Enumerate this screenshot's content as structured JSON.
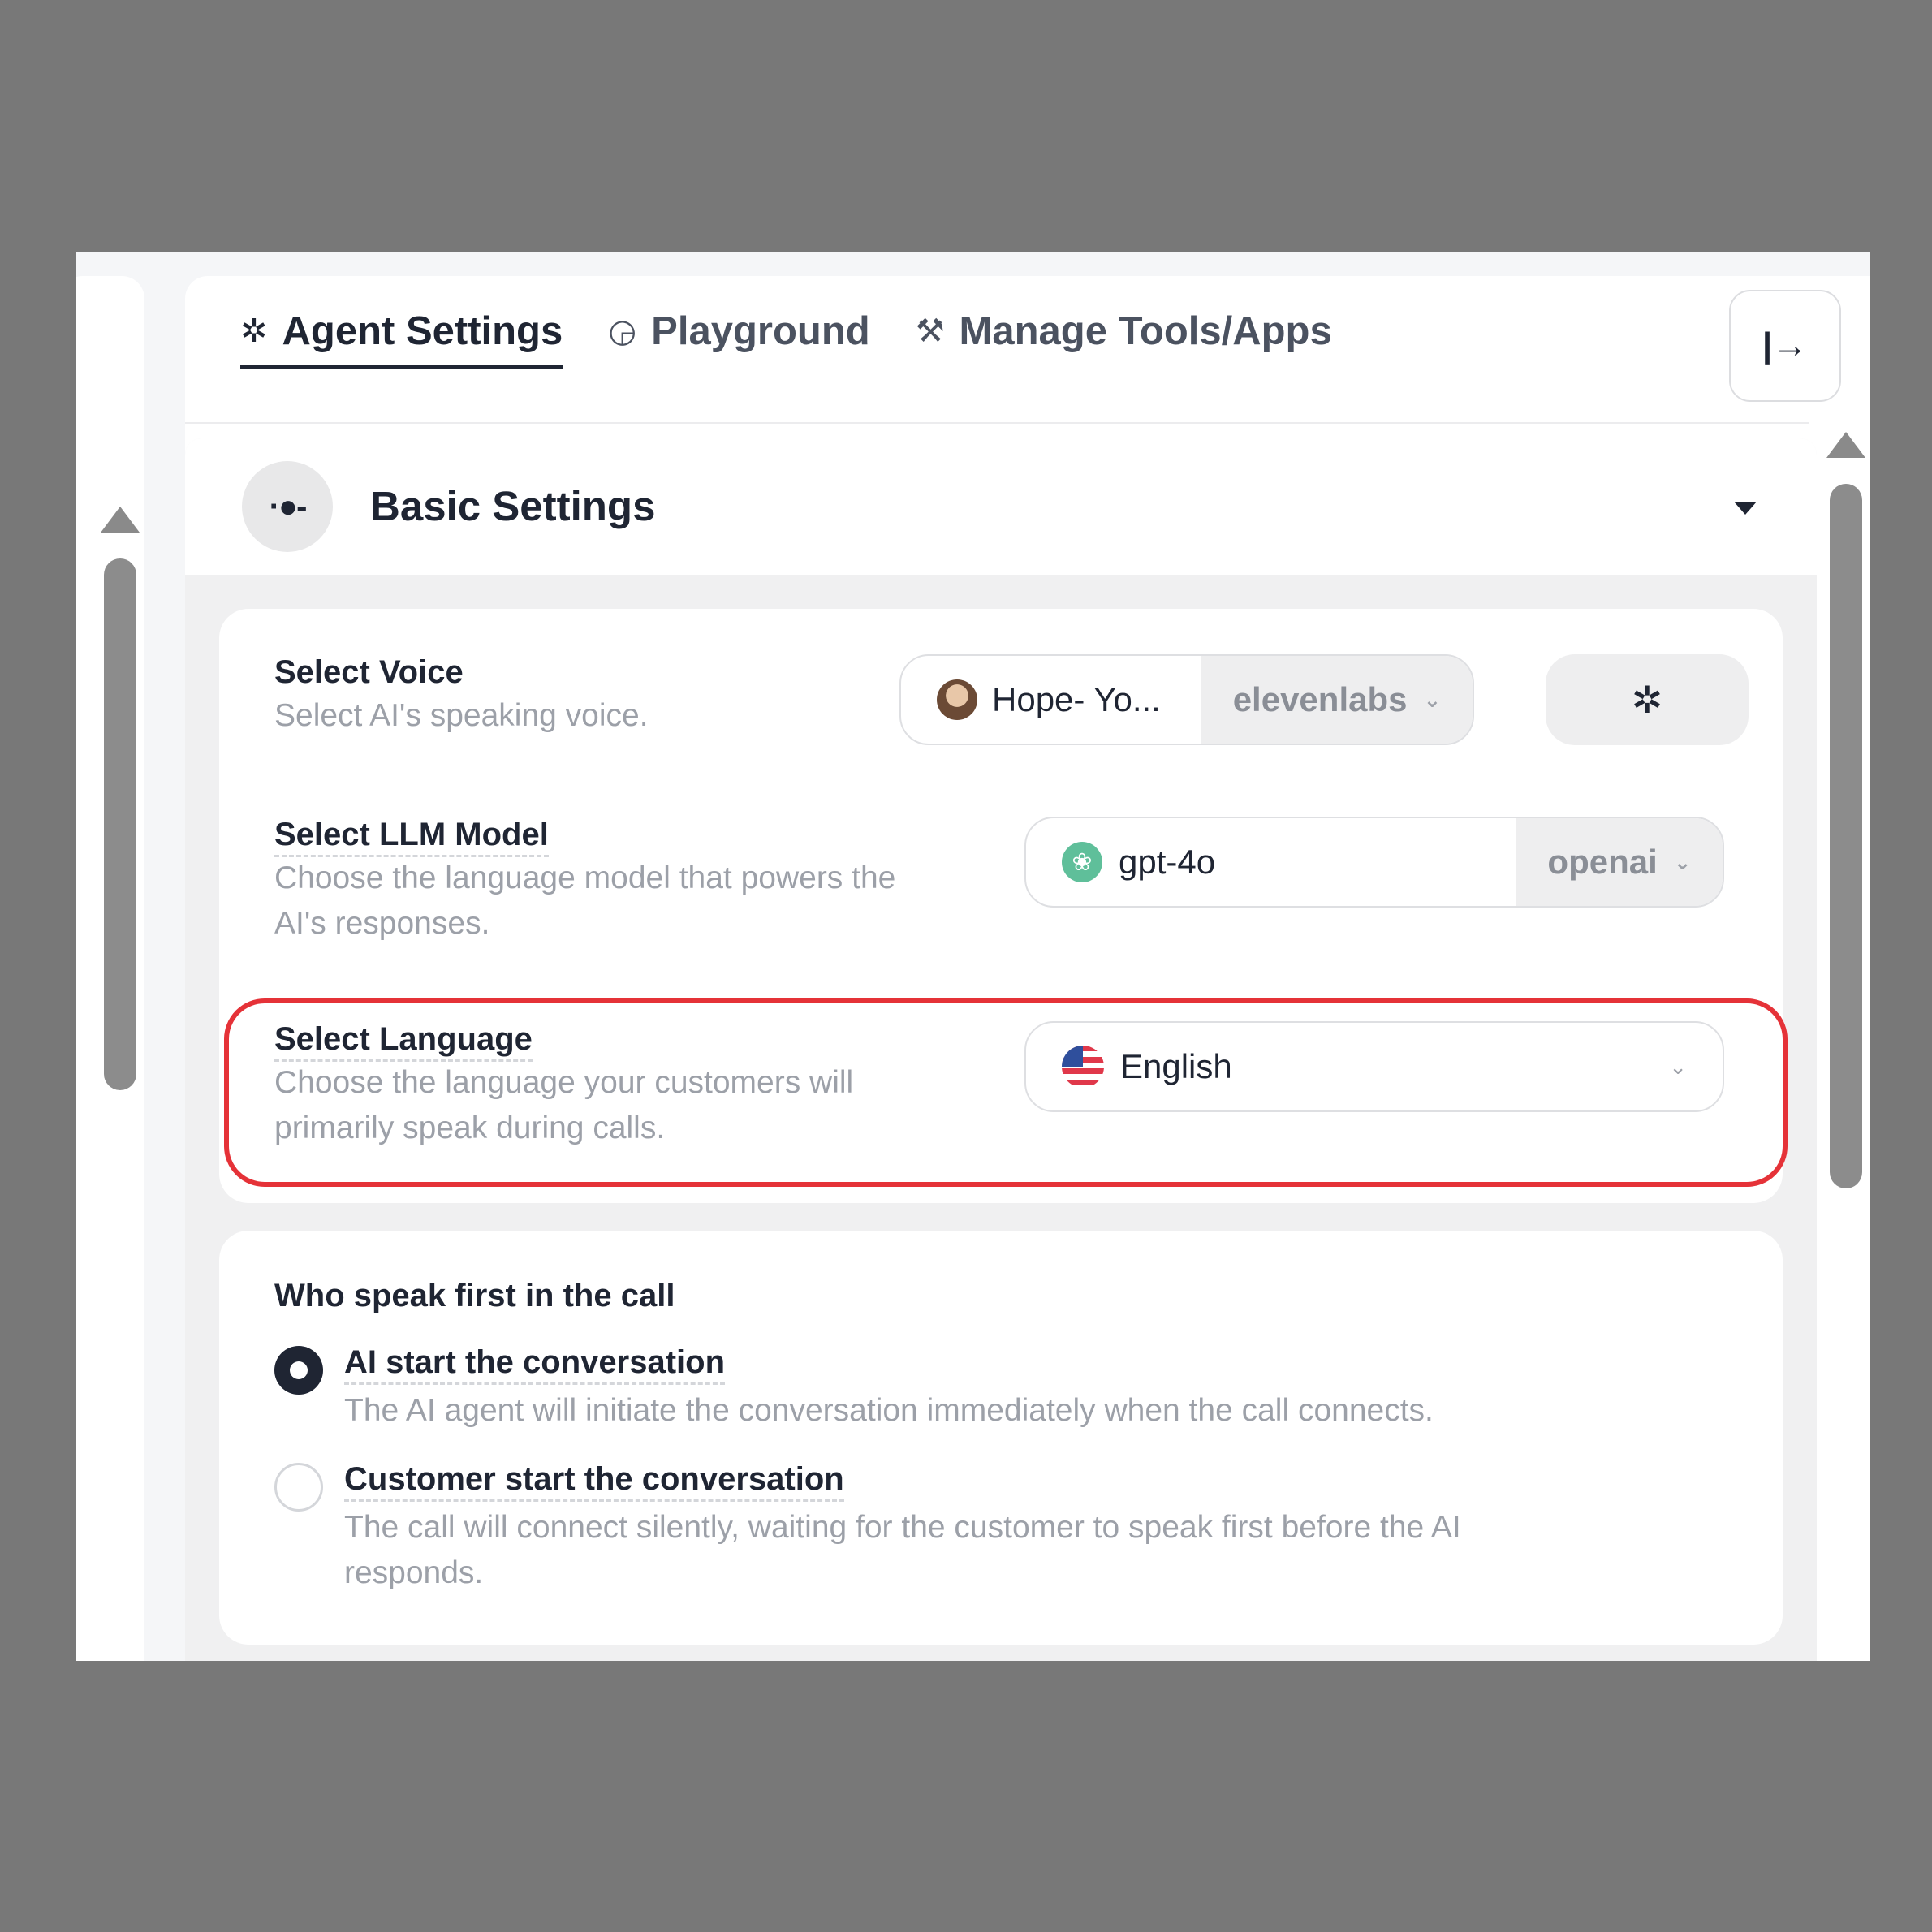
{
  "tabs": [
    {
      "icon": "gear-icon",
      "glyph": "✲",
      "label": "Agent Settings",
      "active": true
    },
    {
      "icon": "playground-icon",
      "glyph": "◶",
      "label": "Playground",
      "active": false
    },
    {
      "icon": "wrench-icon",
      "glyph": "🔧",
      "label": "Manage Tools/Apps",
      "active": false
    }
  ],
  "exit_button": {
    "glyph": "|→"
  },
  "section": {
    "icon_glyph": "·●-",
    "title": "Basic Settings"
  },
  "voice": {
    "label": "Select Voice",
    "description": "Select AI's speaking voice.",
    "value": "Hope- Yo...",
    "provider": "elevenlabs",
    "gear_glyph": "✲"
  },
  "llm": {
    "label": "Select LLM Model",
    "description_line1": "Choose the language model that powers the",
    "description_line2": "AI's responses.",
    "value": "gpt-4o",
    "provider": "openai"
  },
  "language": {
    "label": "Select Language",
    "description_line1": "Choose the language your customers will",
    "description_line2": "primarily speak during calls.",
    "value": "English"
  },
  "first_speaker": {
    "question": "Who speak first in the call",
    "options": [
      {
        "label": "AI start the conversation",
        "description_line1": "The AI agent will initiate the conversation immediately when the call connects.",
        "selected": true
      },
      {
        "label": "Customer start the conversation",
        "description_line1": "The call will connect silently, waiting for the customer to speak first before the AI",
        "description_line2": "responds.",
        "selected": false
      }
    ]
  },
  "colors": {
    "background": "#787878",
    "text_primary": "#1f2533",
    "text_muted": "#9ca0a8",
    "highlight": "#e53238"
  }
}
